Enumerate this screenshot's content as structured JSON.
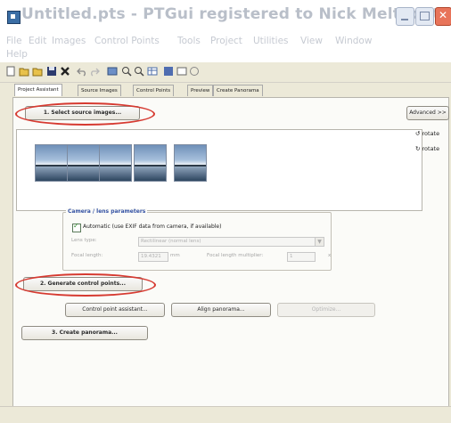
{
  "window": {
    "title": "Untitled.pts - PTGui registered to Nick Meltdonts"
  },
  "menu": [
    "File",
    "Edit",
    "Images",
    "Control Points",
    "Tools",
    "Project",
    "Utilities",
    "View",
    "Window",
    "Help"
  ],
  "toolbar_icons": [
    "new-icon",
    "open-icon",
    "save-icon",
    "delete-icon",
    "undo-icon",
    "redo-icon",
    "panorama-icon",
    "zoom-in-icon",
    "zoom-out-icon",
    "table-icon",
    "editor-icon",
    "refresh-icon",
    "help-icon"
  ],
  "tabs": [
    "Project Assistant",
    "Source Images",
    "Control Points",
    "Preview",
    "Create Panorama"
  ],
  "buttons": {
    "select_source": "1. Select source images...",
    "advanced": "Advanced >>",
    "generate_cp": "2. Generate control points...",
    "cp_assistant": "Control point assistant...",
    "align": "Align panorama...",
    "optimize": "Optimize...",
    "create": "3. Create panorama..."
  },
  "rotate": [
    "rotate",
    "rotate"
  ],
  "camera": {
    "title": "Camera / lens parameters",
    "auto_label": "Automatic (use EXIF data from camera, if available)",
    "lens_type_label": "Lens type:",
    "lens_type_value": "Rectilinear (normal lens)",
    "focal_label": "Focal length:",
    "focal_value": "19.4321",
    "mm_unit": "mm",
    "multiplier_label": "Focal length multiplier:",
    "multiplier_value": "1",
    "x_unit": "x"
  },
  "thumbnails": 5
}
